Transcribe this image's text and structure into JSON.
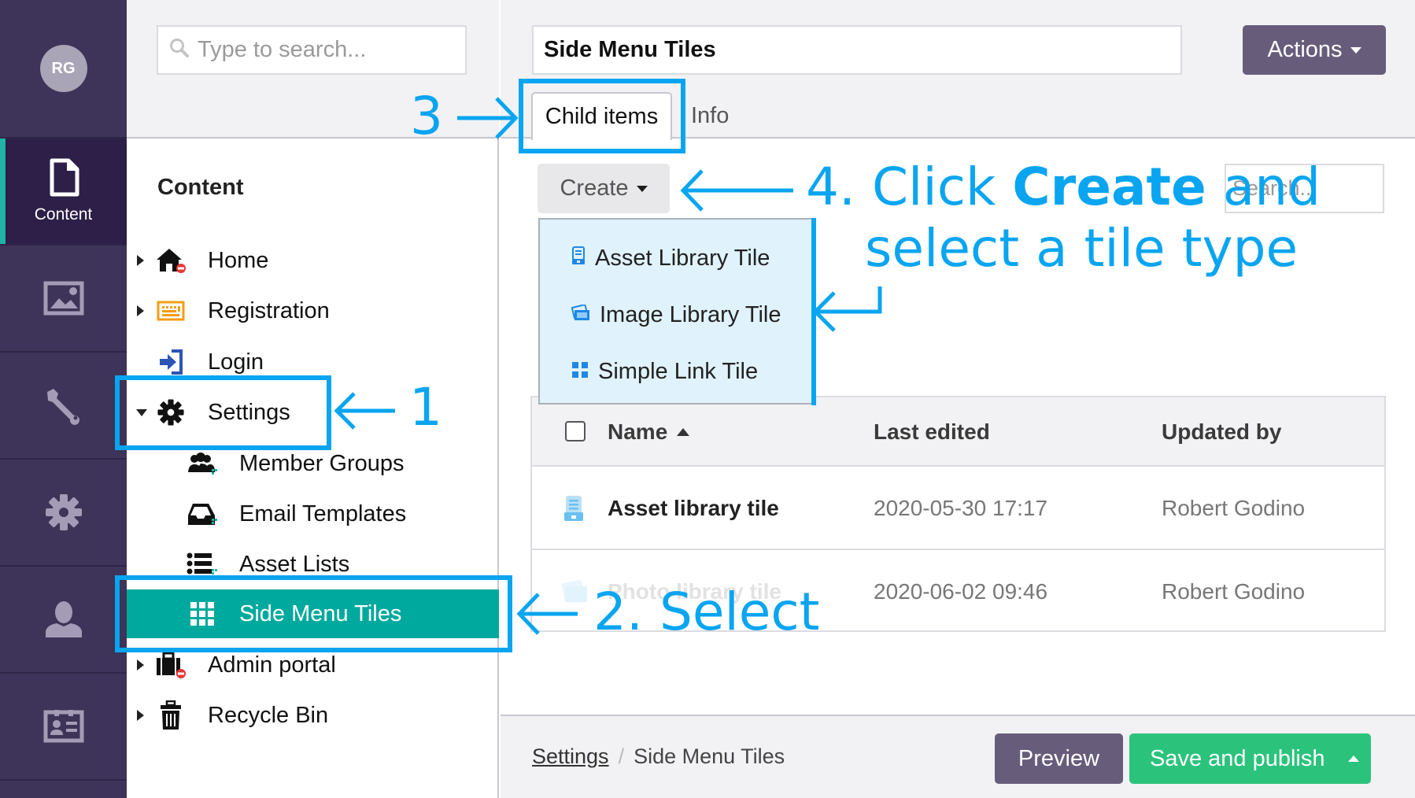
{
  "sidebar": {
    "avatar_initials": "RG",
    "sections": [
      {
        "name": "content",
        "label": "Content",
        "icon": "document-icon",
        "active": true
      },
      {
        "name": "media",
        "label": "",
        "icon": "image-icon",
        "active": false
      },
      {
        "name": "settings-tools",
        "label": "",
        "icon": "wrench-icon",
        "active": false
      },
      {
        "name": "gear",
        "label": "",
        "icon": "gear-icon",
        "active": false
      },
      {
        "name": "members",
        "label": "",
        "icon": "user-icon",
        "active": false
      },
      {
        "name": "forms",
        "label": "",
        "icon": "id-card-icon",
        "active": false
      }
    ]
  },
  "tree": {
    "search_placeholder": "Type to search...",
    "title": "Content",
    "items": [
      {
        "label": "Home",
        "icon": "home-icon",
        "caret": "right",
        "indent": 0
      },
      {
        "label": "Registration",
        "icon": "keyboard-icon",
        "caret": "right",
        "indent": 0
      },
      {
        "label": "Login",
        "icon": "sign-in-icon",
        "caret": "",
        "indent": 0
      },
      {
        "label": "Settings",
        "icon": "gear-icon",
        "caret": "down",
        "indent": 0
      },
      {
        "label": "Member Groups",
        "icon": "users-icon",
        "caret": "",
        "indent": 1
      },
      {
        "label": "Email Templates",
        "icon": "inbox-icon",
        "caret": "",
        "indent": 1
      },
      {
        "label": "Asset Lists",
        "icon": "list-icon",
        "caret": "",
        "indent": 1
      },
      {
        "label": "Side Menu Tiles",
        "icon": "grid-icon",
        "caret": "",
        "indent": 1,
        "selected": true
      },
      {
        "label": "Admin portal",
        "icon": "briefcase-icon",
        "caret": "right",
        "indent": 0
      },
      {
        "label": "Recycle Bin",
        "icon": "trash-icon",
        "caret": "right",
        "indent": 0
      }
    ]
  },
  "main": {
    "node_name": "Side Menu Tiles",
    "actions_label": "Actions",
    "tabs": [
      {
        "label": "Child items",
        "active": true
      },
      {
        "label": "Info",
        "active": false
      }
    ],
    "create_label": "Create",
    "search_placeholder": "Search...",
    "create_menu": [
      {
        "label": "Asset Library Tile",
        "icon": "archive-icon"
      },
      {
        "label": "Image Library Tile",
        "icon": "images-icon"
      },
      {
        "label": "Simple Link Tile",
        "icon": "tiles-icon"
      }
    ],
    "table": {
      "columns": [
        "Name",
        "Last edited",
        "Updated by"
      ],
      "sort_column": "Name",
      "sort_direction": "ascending",
      "rows": [
        {
          "name": "Asset library tile",
          "last_edited": "2020-05-30 17:17",
          "updated_by": "Robert Godino",
          "icon": "archive-icon"
        },
        {
          "name": "Photo library tile",
          "last_edited": "2020-06-02 09:46",
          "updated_by": "Robert Godino",
          "icon": "images-icon"
        }
      ]
    },
    "footer": {
      "breadcrumb": [
        "Settings",
        "Side Menu Tiles"
      ],
      "preview_label": "Preview",
      "publish_label": "Save and publish"
    }
  },
  "annotations": {
    "step1": "1",
    "step2": "2. Select",
    "step3": "3",
    "step4_prefix": "4. Click ",
    "step4_bold": "Create",
    "step4_suffix": " and",
    "step4_line2": "select a tile type"
  },
  "colors": {
    "sidebar_bg": "#3e3358",
    "sidebar_active": "#2d1f48",
    "accent_teal": "#00a99d",
    "actions_purple": "#685c7b",
    "publish_green": "#2bc37c",
    "annotation_blue": "#0aa5f0",
    "dropdown_bg": "#e0f2fc"
  }
}
